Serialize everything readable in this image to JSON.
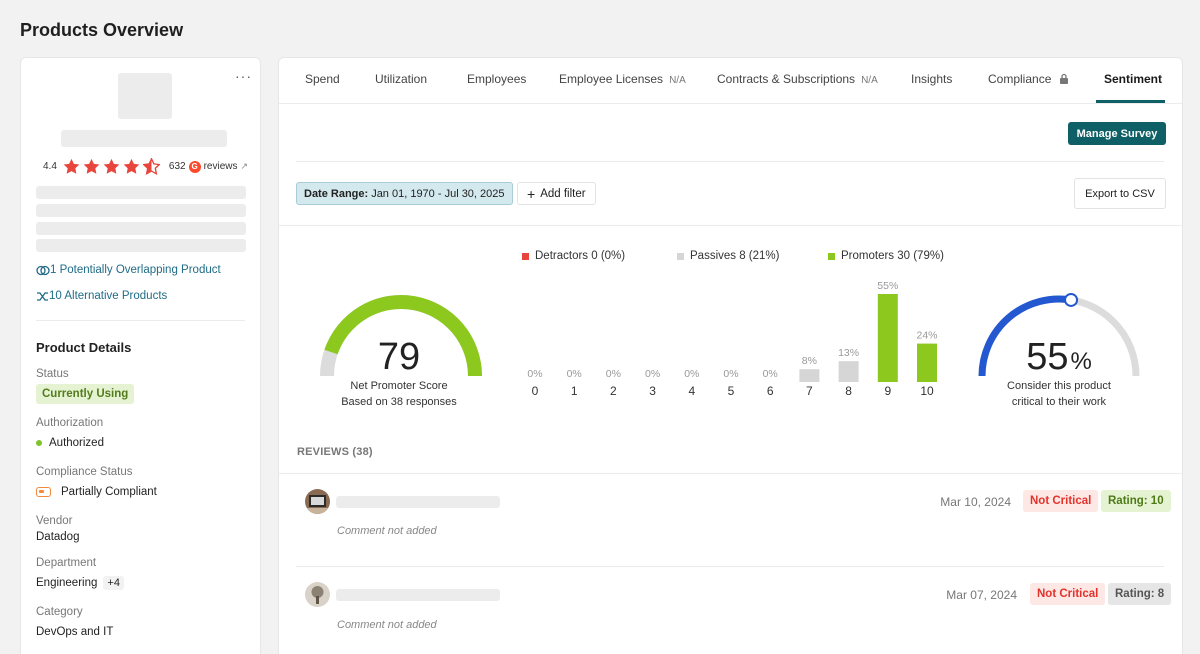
{
  "page_title": "Products Overview",
  "product_card": {
    "more_menu": "···",
    "rating": "4.4",
    "review_count": "632",
    "reviews_label": "reviews",
    "g2_mark": "G",
    "external_icon": "↗",
    "overlap_link": "1 Potentially Overlapping Product",
    "alternatives_link": "10 Alternative Products"
  },
  "product_details": {
    "title": "Product Details",
    "status_label": "Status",
    "status_value": "Currently Using",
    "authorization_label": "Authorization",
    "authorization_value": "Authorized",
    "compliance_label": "Compliance Status",
    "compliance_value": "Partially Compliant",
    "vendor_label": "Vendor",
    "vendor_value": "Datadog",
    "department_label": "Department",
    "department_value": "Engineering",
    "department_more": "+4",
    "category_label": "Category",
    "category_value": "DevOps and IT"
  },
  "tabs": [
    {
      "label": "Spend",
      "na": ""
    },
    {
      "label": "Utilization",
      "na": ""
    },
    {
      "label": "Employees",
      "na": ""
    },
    {
      "label": "Employee Licenses",
      "na": "N/A"
    },
    {
      "label": "Contracts & Subscriptions",
      "na": "N/A"
    },
    {
      "label": "Insights",
      "na": ""
    },
    {
      "label": "Compliance",
      "na": ""
    },
    {
      "label": "Sentiment",
      "na": ""
    }
  ],
  "toolbar": {
    "manage_survey": "Manage Survey",
    "date_range_label": "Date Range:",
    "date_range_value": "Jan 01, 1970 - Jul 30, 2025",
    "add_filter": "Add filter",
    "export": "Export to CSV"
  },
  "legend": {
    "detractors": "Detractors 0 (0%)",
    "passives": "Passives 8 (21%)",
    "promoters": "Promoters 30 (79%)"
  },
  "colors": {
    "detractor": "#e8453c",
    "passive": "#d6d6d6",
    "promoter": "#8cc81e",
    "gauge_blue": "#2358d1",
    "accent": "#0f5f66"
  },
  "nps": {
    "score": "79",
    "score_value": 79,
    "label": "Net Promoter Score",
    "sublabel": "Based on 38 responses"
  },
  "critical": {
    "percent": "55",
    "percent_value": 55,
    "percent_sign": "%",
    "label": "Consider this product",
    "sublabel": "critical to their work"
  },
  "chart_data": {
    "type": "bar",
    "categories": [
      "0",
      "1",
      "2",
      "3",
      "4",
      "5",
      "6",
      "7",
      "8",
      "9",
      "10"
    ],
    "values": [
      0,
      0,
      0,
      0,
      0,
      0,
      0,
      8,
      13,
      55,
      24
    ],
    "value_labels": [
      "0%",
      "0%",
      "0%",
      "0%",
      "0%",
      "0%",
      "0%",
      "8%",
      "13%",
      "55%",
      "24%"
    ],
    "ylim": [
      0,
      55
    ],
    "grid": false
  },
  "reviews": {
    "heading": "REVIEWS (38)",
    "items": [
      {
        "date": "Mar 10, 2024",
        "critical": "Not Critical",
        "rating": "Rating: 10",
        "rating_style": "green",
        "comment": "Comment not added"
      },
      {
        "date": "Mar 07, 2024",
        "critical": "Not Critical",
        "rating": "Rating: 8",
        "rating_style": "grey",
        "comment": "Comment not added"
      }
    ]
  },
  "icons": {
    "star": "star-icon",
    "half_star": "half-star-icon",
    "overlap": "overlap-icon",
    "alternatives": "shuffle-icon",
    "lock": "lock-icon",
    "plus": "plus-icon"
  }
}
